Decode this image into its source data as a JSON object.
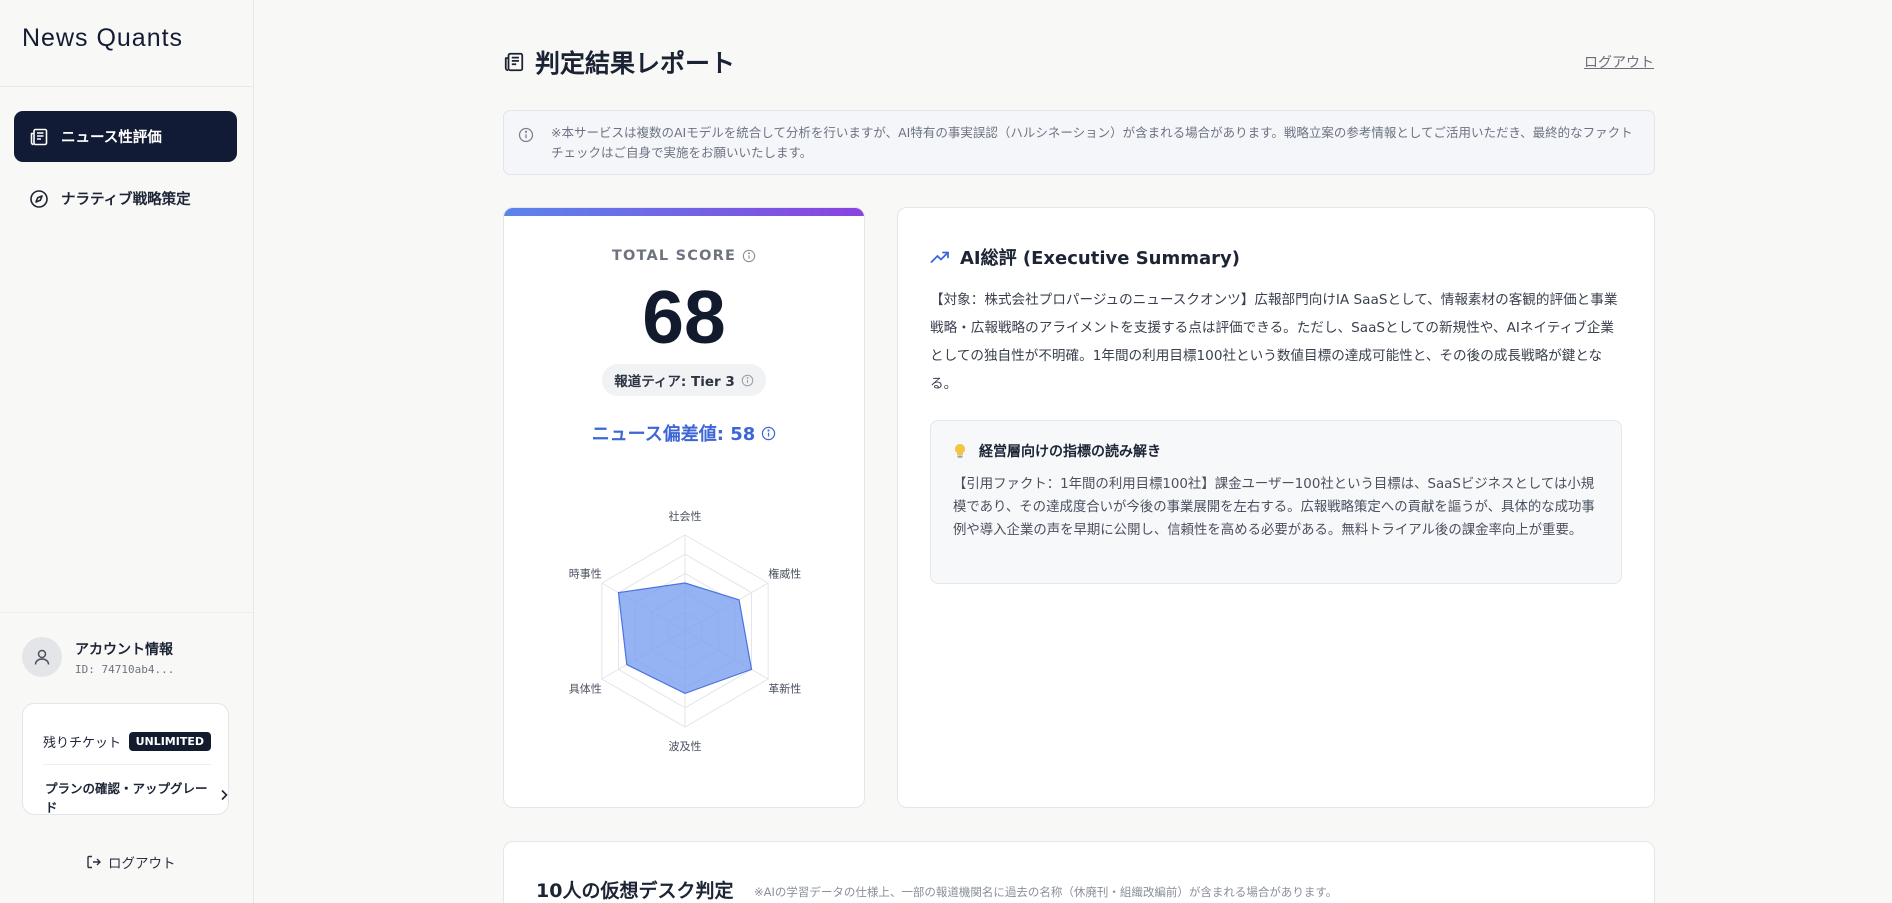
{
  "sidebar": {
    "brand": "News Quants",
    "nav": [
      {
        "label": "ニュース性評価",
        "icon": "newspaper-icon",
        "active": true
      },
      {
        "label": "ナラティブ戦略策定",
        "icon": "compass-icon",
        "active": false
      }
    ],
    "account": {
      "title": "アカウント情報",
      "id": "ID: 74710ab4..."
    },
    "tickets": {
      "label": "残りチケット",
      "badge": "UNLIMITED",
      "plan_link": "プランの確認・アップグレード"
    },
    "logout": "ログアウト"
  },
  "header": {
    "title": "判定結果レポート",
    "logout": "ログアウト"
  },
  "notice": "※本サービスは複数のAIモデルを統合して分析を行いますが、AI特有の事実誤認（ハルシネーション）が含まれる場合があります。戦略立案の参考情報としてご活用いただき、最終的なファクトチェックはご自身で実施をお願いいたします。",
  "score": {
    "total_label": "TOTAL SCORE",
    "total_value": "68",
    "tier": "報道ティア: Tier 3",
    "deviation": "ニュース偏差値: 58"
  },
  "radar": {
    "axes": [
      "社会性",
      "権威性",
      "革新性",
      "波及性",
      "具体性",
      "時事性"
    ],
    "values": [
      0.5,
      0.65,
      0.8,
      0.65,
      0.7,
      0.8
    ],
    "max": 1,
    "fill": "#7b9ff0",
    "stroke": "#4b73e0"
  },
  "summary": {
    "title": "AI総評 (Executive Summary)",
    "body": "【対象：株式会社プロパージュのニュースクオンツ】広報部門向けIA SaaSとして、情報素材の客観的評価と事業戦略・広報戦略のアライメントを支援する点は評価できる。ただし、SaaSとしての新規性や、AIネイティブ企業としての独自性が不明確。1年間の利用目標100社という数値目標の達成可能性と、その後の成長戦略が鍵となる。",
    "insight_title": "経営層向けの指標の読み解き",
    "insight_body": "【引用ファクト：1年間の利用目標100社】課金ユーザー100社という目標は、SaaSビジネスとしては小規模であり、その達成度合いが今後の事業展開を左右する。広報戦略策定への貢献を謳うが、具体的な成功事例や導入企業の声を早期に公開し、信頼性を高める必要がある。無料トライアル後の課金率向上が重要。"
  },
  "desk": {
    "title": "10人の仮想デスク判定",
    "note": "※AIの学習データの仕様上、一部の報道機関名に過去の名称（休廃刊・組織改編前）が含まれる場合があります。"
  }
}
